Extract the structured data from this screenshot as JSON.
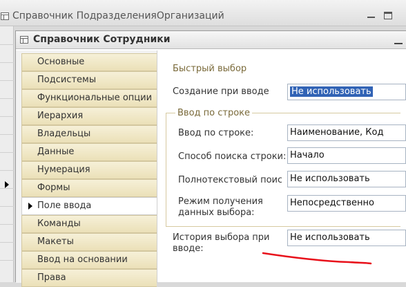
{
  "back_window": {
    "title": "Справочник ПодразделенияОрганизаций"
  },
  "front_window": {
    "title": "Справочник Сотрудники"
  },
  "nav": {
    "items": [
      {
        "label": "Основные",
        "active": false
      },
      {
        "label": "Подсистемы",
        "active": false
      },
      {
        "label": "Функциональные опции",
        "active": false
      },
      {
        "label": "Иерархия",
        "active": false
      },
      {
        "label": "Владельцы",
        "active": false
      },
      {
        "label": "Данные",
        "active": false
      },
      {
        "label": "Нумерация",
        "active": false
      },
      {
        "label": "Формы",
        "active": false
      },
      {
        "label": "Поле ввода",
        "active": true
      },
      {
        "label": "Команды",
        "active": false
      },
      {
        "label": "Макеты",
        "active": false
      },
      {
        "label": "Ввод на основании",
        "active": false
      },
      {
        "label": "Права",
        "active": false
      }
    ]
  },
  "form": {
    "quick_choice_header": "Быстрый выбор",
    "create_on_input": {
      "label": "Создание при вводе",
      "value": "Не использовать"
    },
    "input_by_string_group": "Ввод по строке",
    "input_by_string": {
      "label": "Ввод по строке:",
      "value": "Наименование, Код"
    },
    "search_method": {
      "label": "Способ поиска строки:",
      "value": "Начало"
    },
    "fulltext_search": {
      "label": "Полнотекстовый поиск",
      "value": "Не использовать"
    },
    "data_mode": {
      "label_line1": "Режим получения",
      "label_line2": "данных выбора:",
      "value": "Непосредственно"
    },
    "choice_history": {
      "label_line1": "История выбора при",
      "label_line2": "вводе:",
      "value": "Не использовать"
    }
  },
  "annotation": {
    "color": "#e8101a"
  }
}
